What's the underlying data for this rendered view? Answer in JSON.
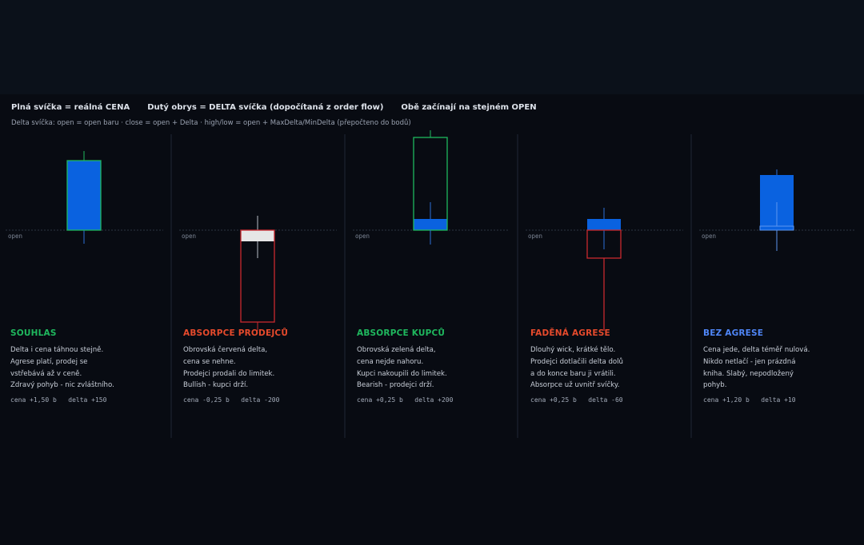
{
  "header": {
    "legend": [
      "Plná svíčka = reálná CENA",
      "Dutý obrys = DELTA svíčka (dopočítaná z order flow)",
      "Obě začínají na stejném OPEN"
    ],
    "formula": "Delta svíčka: open = open baru   ·   close = open + Delta   ·   high/low = open + MaxDelta/MinDelta   (přepočteno do bodů)"
  },
  "colors": {
    "background": "#080b12",
    "price_body": "#0a62e0",
    "green": "#1fb85e",
    "red": "#c9282f",
    "orange_red": "#e64a2c",
    "blue_label": "#4f86f7",
    "white_body": "#e6e6e6",
    "divider": "#1f2735",
    "open_line": "#3a4354"
  },
  "open_label": "open",
  "panels": [
    {
      "verdict": "SOUHLAS",
      "verdict_color": "#1fb85e",
      "lines": [
        "Delta i cena táhnou stejně.",
        "Agrese platí, prodej se",
        "vstřebává až v ceně.",
        "Zdravý pohyb - nic zvláštního."
      ],
      "stats": "cena +1,50 b   delta +150"
    },
    {
      "verdict": "ABSORPCE PRODEJCŮ",
      "verdict_color": "#e64a2c",
      "lines": [
        "Obrovská červená delta,",
        "cena se nehne.",
        "Prodejci prodali do limitek.",
        "Bullish - kupci drží."
      ],
      "stats": "cena -0,25 b   delta -200"
    },
    {
      "verdict": "ABSORPCE KUPCŮ",
      "verdict_color": "#1fb85e",
      "lines": [
        "Obrovská zelená delta,",
        "cena nejde nahoru.",
        "Kupci nakoupili do limitek.",
        "Bearish - prodejci drží."
      ],
      "stats": "cena +0,25 b   delta +200"
    },
    {
      "verdict": "FADĚNÁ AGRESE",
      "verdict_color": "#e64a2c",
      "lines": [
        "Dlouhý wick, krátké tělo.",
        "Prodejci dotlačili delta dolů",
        "a do konce baru ji vrátili.",
        "Absorpce už uvnitř svíčky."
      ],
      "stats": "cena +0,25 b   delta -60"
    },
    {
      "verdict": "BEZ AGRESE",
      "verdict_color": "#4f86f7",
      "lines": [
        "Cena jede, delta téměř nulová.",
        "Nikdo netlačí - jen prázdná",
        "kniha. Slabý, nepodložený",
        "pohyb."
      ],
      "stats": "cena +1,20 b   delta +10"
    }
  ]
}
